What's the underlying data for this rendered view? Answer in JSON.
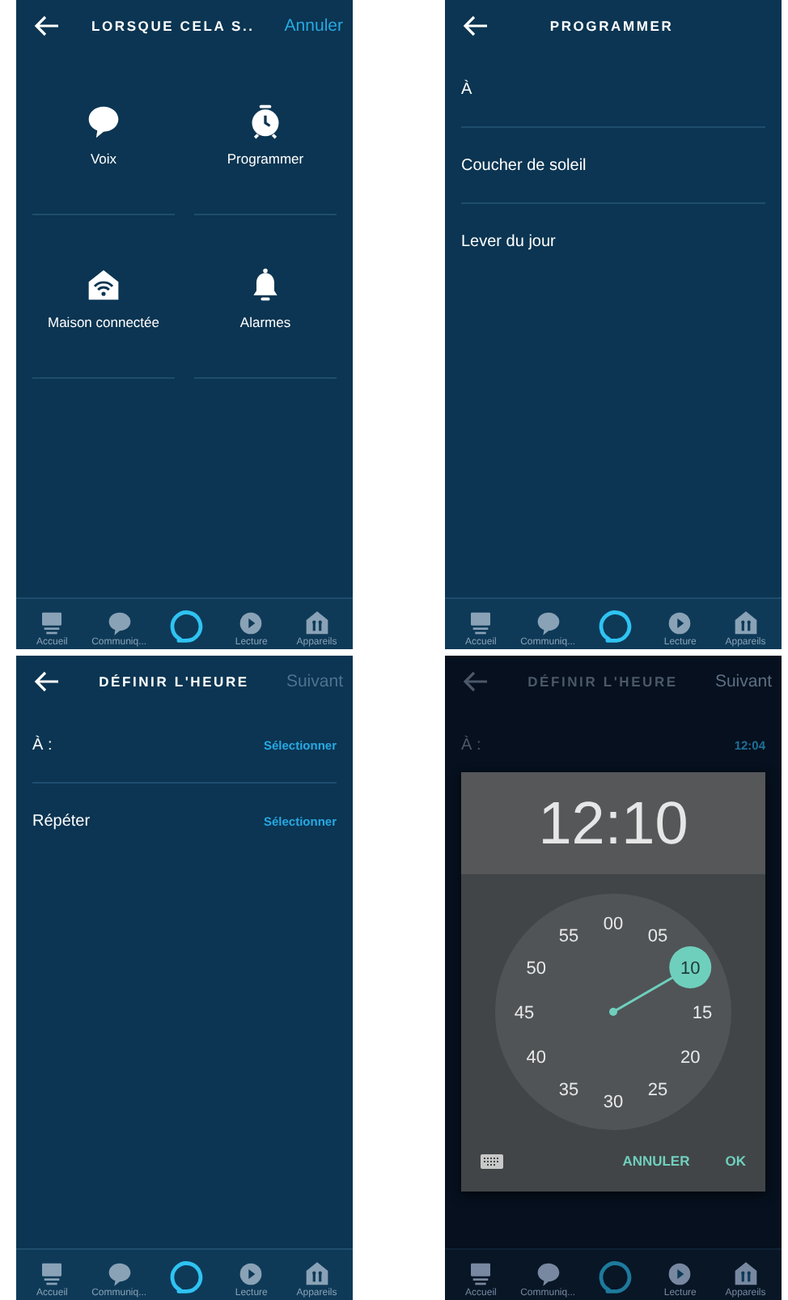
{
  "screens": [
    {
      "kind": "tiles",
      "dimmed": false,
      "title": "LORSQUE CELA S..",
      "action": {
        "label": "Annuler",
        "disabled": false
      },
      "tiles": [
        {
          "kind": "speech",
          "label": "Voix"
        },
        {
          "kind": "alarm-clock",
          "label": "Programmer"
        },
        {
          "kind": "smart-home",
          "label": "Maison connectée"
        },
        {
          "kind": "bell",
          "label": "Alarmes"
        }
      ],
      "nav": [
        {
          "kind": "home",
          "label": "Accueil"
        },
        {
          "kind": "chat",
          "label": "Communiq..."
        },
        {
          "kind": "alexa"
        },
        {
          "kind": "play",
          "label": "Lecture"
        },
        {
          "kind": "devices",
          "label": "Appareils"
        }
      ]
    },
    {
      "kind": "list",
      "dimmed": false,
      "title": "PROGRAMMER",
      "items": [
        "À",
        "Coucher de soleil",
        "Lever du jour"
      ],
      "nav": [
        {
          "kind": "home",
          "label": "Accueil"
        },
        {
          "kind": "chat",
          "label": "Communiq..."
        },
        {
          "kind": "alexa"
        },
        {
          "kind": "play",
          "label": "Lecture"
        },
        {
          "kind": "devices",
          "label": "Appareils"
        }
      ]
    },
    {
      "kind": "fields",
      "dimmed": false,
      "title": "DÉFINIR L'HEURE",
      "action": {
        "label": "Suivant",
        "disabled": true
      },
      "rows": [
        {
          "label": "À :",
          "value": "Sélectionner"
        },
        {
          "label": "Répéter",
          "value": "Sélectionner"
        }
      ],
      "nav": [
        {
          "kind": "home",
          "label": "Accueil"
        },
        {
          "kind": "chat",
          "label": "Communiq..."
        },
        {
          "kind": "alexa"
        },
        {
          "kind": "play",
          "label": "Lecture"
        },
        {
          "kind": "devices",
          "label": "Appareils"
        }
      ]
    },
    {
      "kind": "fields",
      "dimmed": true,
      "title": "DÉFINIR L'HEURE",
      "action": {
        "label": "Suivant",
        "disabled": true
      },
      "rows": [
        {
          "label": "À :",
          "value": "12:04"
        }
      ],
      "dialog": {
        "time": "12:10",
        "minutes": [
          {
            "label": "00",
            "selected": false
          },
          {
            "label": "05",
            "selected": false
          },
          {
            "label": "10",
            "selected": true
          },
          {
            "label": "15",
            "selected": false
          },
          {
            "label": "20",
            "selected": false
          },
          {
            "label": "25",
            "selected": false
          },
          {
            "label": "30",
            "selected": false
          },
          {
            "label": "35",
            "selected": false
          },
          {
            "label": "40",
            "selected": false
          },
          {
            "label": "45",
            "selected": false
          },
          {
            "label": "50",
            "selected": false
          },
          {
            "label": "55",
            "selected": false
          }
        ],
        "buttons": [
          "ANNULER",
          "OK"
        ]
      },
      "nav": [
        {
          "kind": "home",
          "label": "Accueil"
        },
        {
          "kind": "chat",
          "label": "Communiq..."
        },
        {
          "kind": "alexa"
        },
        {
          "kind": "play",
          "label": "Lecture"
        },
        {
          "kind": "devices",
          "label": "Appareils"
        }
      ]
    }
  ]
}
